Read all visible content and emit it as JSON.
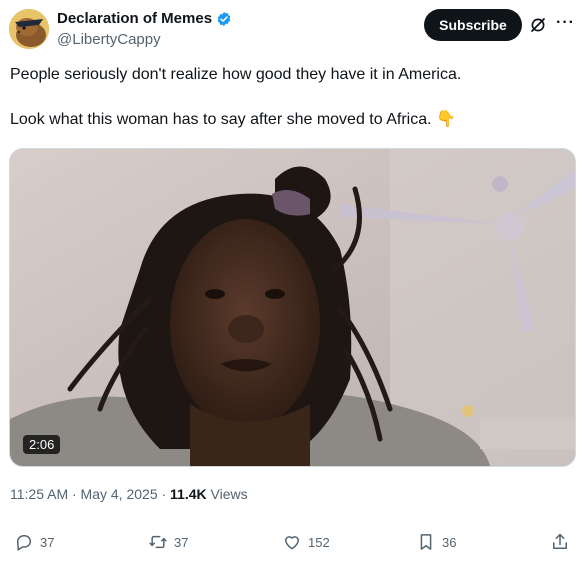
{
  "author": {
    "display_name": "Declaration of Memes",
    "handle": "@LibertyCappy"
  },
  "header": {
    "subscribe_label": "Subscribe",
    "more_label": "···"
  },
  "tweet": {
    "line1": "People seriously don't realize how good they have it in America.",
    "line2": "Look what this woman has to say after she moved to Africa. 👇"
  },
  "media": {
    "duration": "2:06"
  },
  "meta": {
    "time_date": "11:25 AM · May 4, 2025 · ",
    "views_count": "11.4K",
    "views_label": " Views"
  },
  "actions": {
    "replies": "37",
    "reposts": "37",
    "likes": "152",
    "bookmarks": "36"
  },
  "colors": {
    "text_primary": "#0f1419",
    "text_secondary": "#536471",
    "verified_blue": "#1d9bf0",
    "subscribe_bg": "#0f1419"
  }
}
